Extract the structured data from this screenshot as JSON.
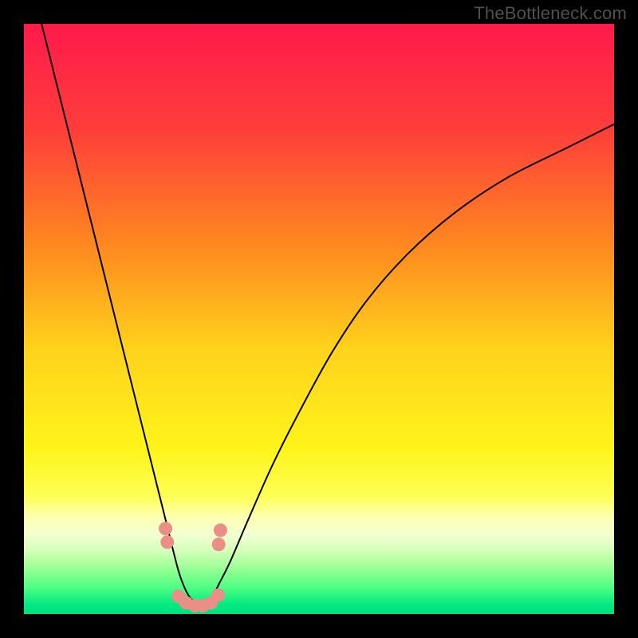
{
  "watermark": "TheBottleneck.com",
  "colors": {
    "frame": "#000000",
    "gradient_stops": [
      {
        "offset": 0.0,
        "color": "#ff1a4b"
      },
      {
        "offset": 0.18,
        "color": "#ff3e3a"
      },
      {
        "offset": 0.38,
        "color": "#ff8a1f"
      },
      {
        "offset": 0.55,
        "color": "#ffd21c"
      },
      {
        "offset": 0.72,
        "color": "#fff41a"
      },
      {
        "offset": 0.8,
        "color": "#fdff54"
      },
      {
        "offset": 0.835,
        "color": "#ffffb0"
      },
      {
        "offset": 0.865,
        "color": "#f3ffd2"
      },
      {
        "offset": 0.892,
        "color": "#d6ffba"
      },
      {
        "offset": 0.92,
        "color": "#9fff97"
      },
      {
        "offset": 0.955,
        "color": "#4dff83"
      },
      {
        "offset": 0.985,
        "color": "#00e982"
      },
      {
        "offset": 1.0,
        "color": "#00e07e"
      }
    ],
    "curve": "#000000",
    "marker": "#e98f87"
  },
  "chart_data": {
    "type": "line",
    "title": "",
    "xlabel": "",
    "ylabel": "",
    "xlim": [
      0,
      100
    ],
    "ylim": [
      0,
      100
    ],
    "series": [
      {
        "name": "bottleneck-curve",
        "x": [
          3,
          6,
          9,
          12,
          15,
          18,
          21,
          24,
          26,
          27,
          28,
          29,
          30,
          31,
          32,
          33,
          35,
          38,
          42,
          46,
          52,
          58,
          65,
          73,
          82,
          92,
          100
        ],
        "y": [
          100,
          88,
          76,
          64,
          52,
          40,
          28,
          16,
          8,
          5,
          3,
          2,
          1.5,
          2,
          3,
          5,
          9,
          16,
          25,
          33,
          44,
          53,
          61,
          68,
          74,
          79,
          83
        ]
      }
    ],
    "markers": {
      "name": "highlighted-points",
      "x": [
        24.0,
        24.3,
        26.2,
        27.5,
        29.0,
        30.3,
        31.7,
        32.9,
        33.0,
        33.3
      ],
      "y": [
        14.5,
        12.2,
        3.0,
        1.9,
        1.4,
        1.4,
        1.9,
        3.2,
        11.8,
        14.2
      ]
    }
  }
}
